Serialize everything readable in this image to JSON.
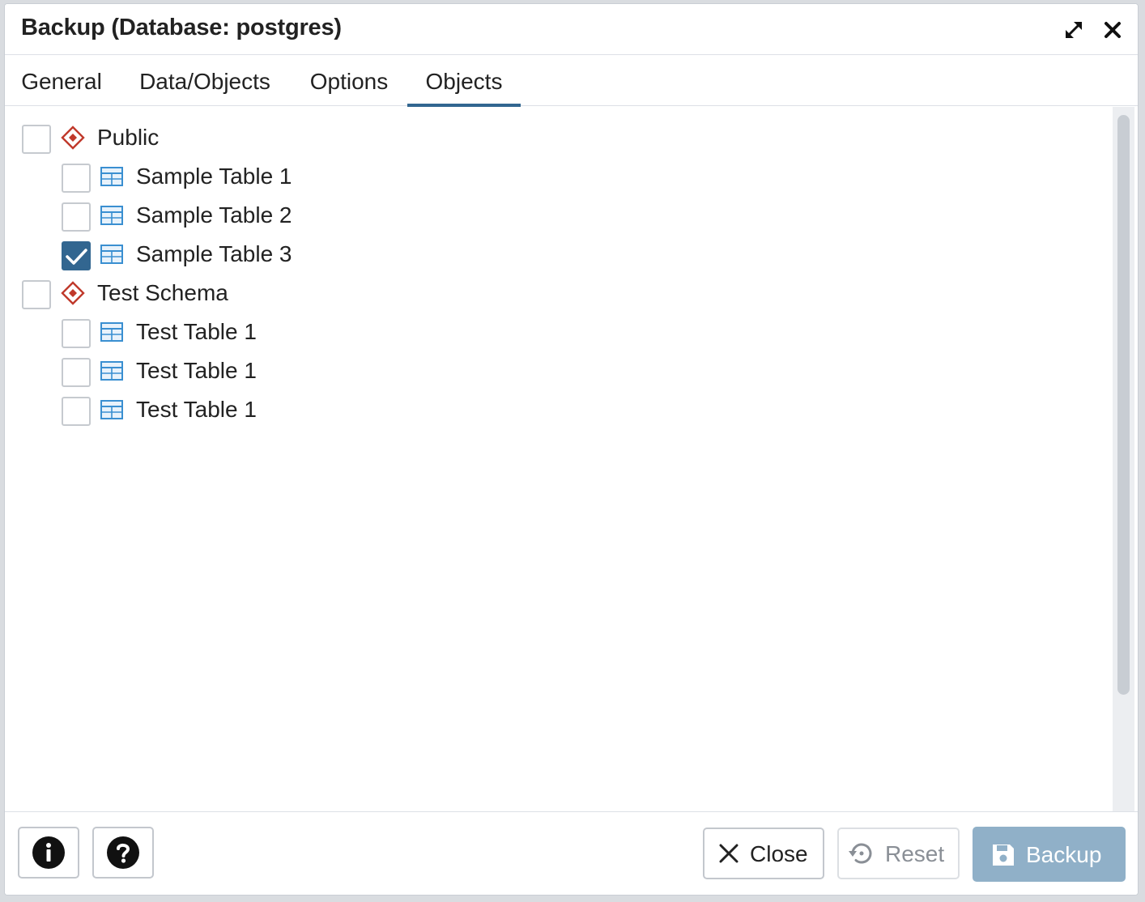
{
  "dialog": {
    "title": "Backup (Database: postgres)",
    "controls": [
      {
        "name": "maximize",
        "icon": "expand-icon"
      },
      {
        "name": "close",
        "icon": "close-icon"
      }
    ]
  },
  "tabs": [
    {
      "label": "General",
      "active": false
    },
    {
      "label": "Data/Objects",
      "active": false
    },
    {
      "label": "Options",
      "active": false
    },
    {
      "label": "Objects",
      "active": true
    }
  ],
  "tree": [
    {
      "type": "schema",
      "label": "Public",
      "checked": false,
      "icon": "schema-diamond-icon"
    },
    {
      "type": "table",
      "label": "Sample Table 1",
      "checked": false,
      "icon": "table-icon"
    },
    {
      "type": "table",
      "label": "Sample Table 2",
      "checked": false,
      "icon": "table-icon"
    },
    {
      "type": "table",
      "label": "Sample Table 3",
      "checked": true,
      "icon": "table-icon"
    },
    {
      "type": "schema",
      "label": "Test Schema",
      "checked": false,
      "icon": "schema-diamond-icon"
    },
    {
      "type": "table",
      "label": "Test Table 1",
      "checked": false,
      "icon": "table-icon"
    },
    {
      "type": "table",
      "label": "Test Table 1",
      "checked": false,
      "icon": "table-icon"
    },
    {
      "type": "table",
      "label": "Test Table 1",
      "checked": false,
      "icon": "table-icon"
    }
  ],
  "footer": {
    "info_icon": "info-icon",
    "help_icon": "help-icon",
    "close_label": "Close",
    "reset_label": "Reset",
    "backup_label": "Backup"
  },
  "colors": {
    "accent": "#326690",
    "schema_icon": "#c0392b",
    "table_icon": "#3a8fd1",
    "primary_button": "#90b0c8"
  }
}
